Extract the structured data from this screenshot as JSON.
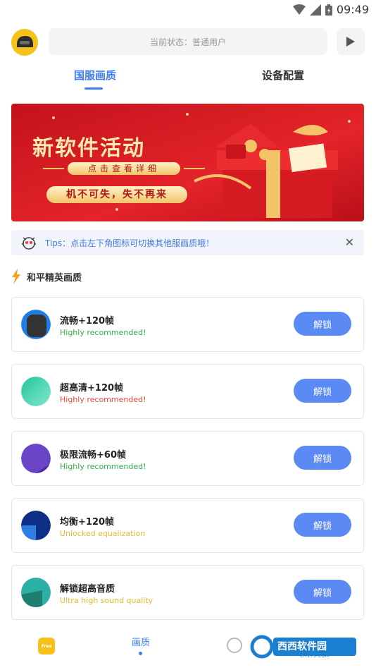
{
  "status_bar": {
    "time": "09:49"
  },
  "header": {
    "status_text": "当前状态：普通用户"
  },
  "tabs": [
    {
      "label": "国服画质",
      "active": true
    },
    {
      "label": "设备配置",
      "active": false
    }
  ],
  "banner": {
    "title": "新软件活动",
    "link_text": "点击查看详细",
    "slogan": "机不可失，失不再来"
  },
  "tips": {
    "text": "Tips：点击左下角图标可切换其他服画质哦！"
  },
  "section": {
    "title": "和平精英画质"
  },
  "cards": [
    {
      "title": "流畅+120帧",
      "subtitle": "Highly recommended!",
      "subtitle_color": "#2fae4a",
      "button": "解锁"
    },
    {
      "title": "超高清+120帧",
      "subtitle": "Highly recommended!",
      "subtitle_color": "#e84a3c",
      "button": "解锁"
    },
    {
      "title": "极限流畅+60帧",
      "subtitle": "Highly recommended!",
      "subtitle_color": "#2fae4a",
      "button": "解锁"
    },
    {
      "title": "均衡+120帧",
      "subtitle": "Unlocked equalization",
      "subtitle_color": "#e7b92c",
      "button": "解锁"
    },
    {
      "title": "解锁超高音质",
      "subtitle": "Ultra high sound quality",
      "subtitle_color": "#e7b92c",
      "button": "解锁"
    }
  ],
  "bottom_nav": {
    "left_icon_text": "Free",
    "middle_label": "画质"
  },
  "watermark": {
    "brand": "西西软件园",
    "domain": "CR173.COM"
  },
  "colors": {
    "accent": "#3d7cf0",
    "button": "#5b8af4"
  }
}
